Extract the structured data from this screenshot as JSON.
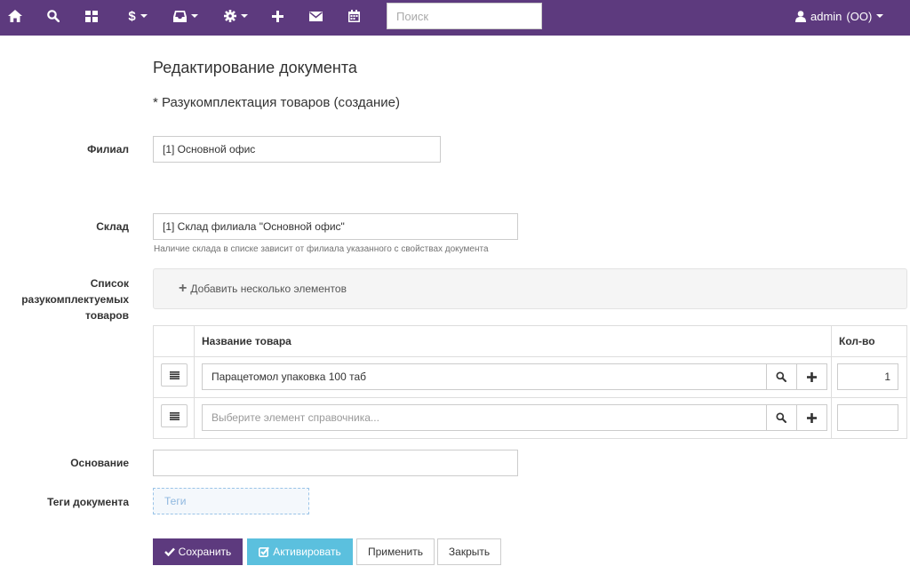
{
  "nav": {
    "search_placeholder": "Поиск",
    "user": {
      "name": "admin",
      "org": "(ОО)"
    },
    "icons": [
      "home-icon",
      "search-icon",
      "dashboard-icon",
      "dollar-icon",
      "inbox-icon",
      "gear-icon",
      "plus-icon",
      "envelope-icon",
      "calendar-icon",
      "user-icon"
    ],
    "dollar_glyph": "$",
    "brand_color": "#5d3a7e"
  },
  "page": {
    "title": "Редактирование документа",
    "subtitle": "* Разукомплектация товаров (создание)"
  },
  "form": {
    "branch": {
      "label": "Филиал",
      "value": "[1] Основной офис"
    },
    "warehouse": {
      "label": "Склад",
      "value": "[1] Склад филиала \"Основной офис\"",
      "help": "Наличие склада в списке зависит от филиала указанного с свойствах документа"
    },
    "items": {
      "label_lines": [
        "Список",
        "разукомплектуемых",
        "товаров"
      ],
      "add_label": "Добавить несколько элементов",
      "columns": {
        "name": "Название товара",
        "qty": "Кол-во"
      },
      "rows": [
        {
          "name": "Парацетомол упаковка 100 таб",
          "qty": "1"
        },
        {
          "name": "",
          "placeholder": "Выберите элемент справочника...",
          "qty": ""
        }
      ]
    },
    "basis": {
      "label": "Основание",
      "value": ""
    },
    "tags": {
      "label": "Теги документа",
      "placeholder": "Теги"
    }
  },
  "buttons": {
    "save": "Сохранить",
    "activate": "Активировать",
    "apply": "Применить",
    "close": "Закрыть",
    "save_color": "#5d3a7e",
    "activate_color": "#5bc0de"
  }
}
